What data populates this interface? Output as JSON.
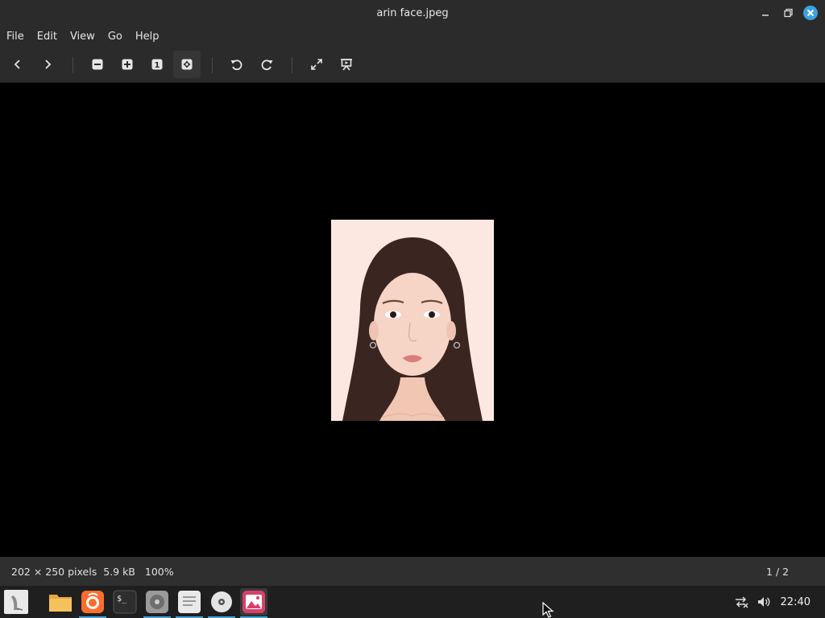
{
  "window": {
    "title": "arin face.jpeg",
    "controls": [
      "minimize-icon",
      "restore-icon",
      "close-icon"
    ],
    "close_color": "#3aa2e0"
  },
  "menu": {
    "items": [
      "File",
      "Edit",
      "View",
      "Go",
      "Help"
    ]
  },
  "toolbar": {
    "buttons": [
      {
        "icon": "previous-icon"
      },
      {
        "icon": "next-icon"
      },
      {
        "icon": "zoom-out-icon"
      },
      {
        "icon": "zoom-in-icon"
      },
      {
        "icon": "zoom-normal-icon",
        "glyph": "1"
      },
      {
        "icon": "zoom-fit-icon",
        "active": true
      },
      {
        "icon": "rotate-left-icon"
      },
      {
        "icon": "rotate-right-icon"
      },
      {
        "icon": "fullscreen-icon"
      },
      {
        "icon": "slideshow-icon"
      }
    ]
  },
  "image": {
    "subject": "portrait photo"
  },
  "status": {
    "dimensions": "202 × 250 pixels",
    "size": "5.9 kB",
    "zoom": "100%",
    "position": "1 / 2"
  },
  "taskbar": {
    "items": [
      {
        "icon": "menu-icon"
      },
      {
        "icon": "files-icon"
      },
      {
        "icon": "firefox-icon",
        "running": true
      },
      {
        "icon": "terminal-icon",
        "glyph": "$_"
      },
      {
        "icon": "disks-icon",
        "running": true
      },
      {
        "icon": "text-editor-icon",
        "running": true
      },
      {
        "icon": "disc-icon",
        "running": true
      },
      {
        "icon": "image-viewer-icon",
        "running": true,
        "active": true
      }
    ],
    "tray": [
      "network-disconnected-icon",
      "volume-icon"
    ],
    "clock": "22:40"
  },
  "colors": {
    "accent": "#4aa3d9",
    "chrome": "#2b2b2b",
    "canvas": "#000000"
  }
}
